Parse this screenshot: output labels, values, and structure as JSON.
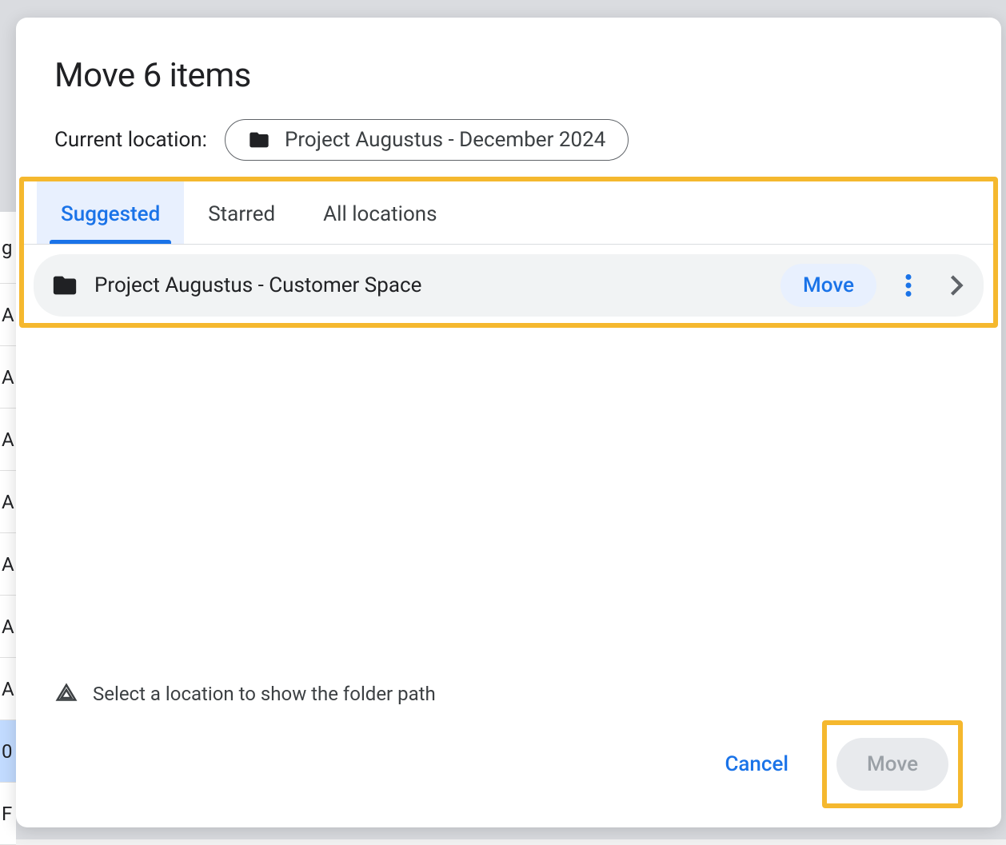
{
  "dialog": {
    "title": "Move 6 items",
    "current_location_label": "Current location:",
    "current_location_name": "Project Augustus - December 2024",
    "tabs": {
      "suggested": "Suggested",
      "starred": "Starred",
      "all": "All locations"
    },
    "folder_item": {
      "icon": "folder-icon",
      "name": "Project Augustus - Customer Space",
      "move_label": "Move"
    },
    "footer_hint": "Select a location to show the folder path",
    "actions": {
      "cancel": "Cancel",
      "move": "Move"
    }
  },
  "background_cells": [
    "g",
    "A",
    "A",
    "A",
    "A",
    "A",
    "A",
    "A",
    "0",
    "F"
  ]
}
